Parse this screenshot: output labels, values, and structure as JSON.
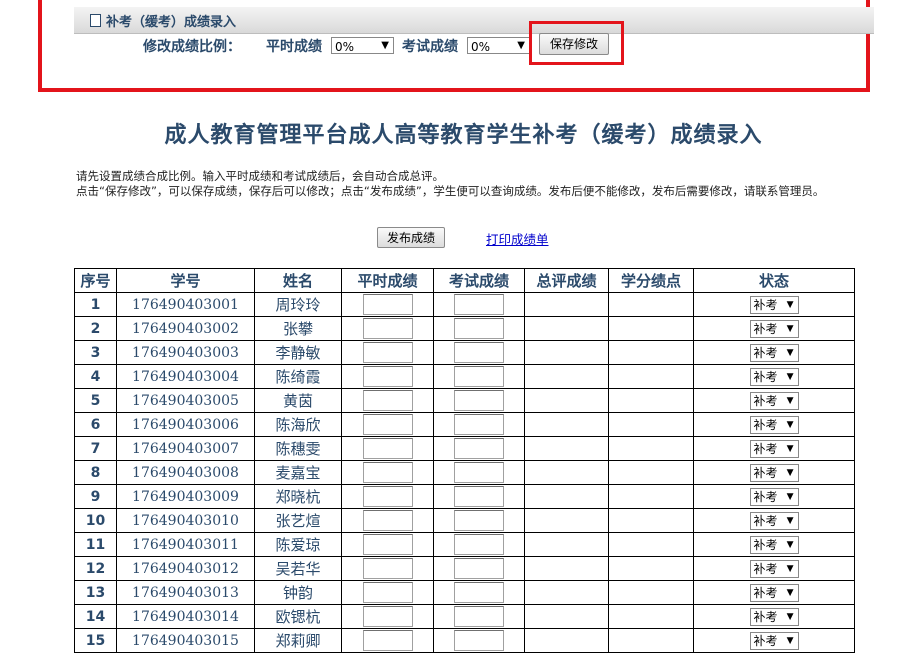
{
  "panel": {
    "title": "补考（缓考）成绩录入"
  },
  "ratio": {
    "label": "修改成绩比例：",
    "regular_label": "平时成绩",
    "regular_value": "0%",
    "exam_label": "考试成绩",
    "exam_value": "0%",
    "save_label": "保存修改"
  },
  "page_title": "成人教育管理平台成人高等教育学生补考（缓考）成绩录入",
  "notes": {
    "line1": "请先设置成绩合成比例。输入平时成绩和考试成绩后，会自动合成总评。",
    "line2": "点击“保存修改”，可以保存成绩，保存后可以修改；点击“发布成绩”，学生便可以查询成绩。发布后便不能修改，发布后需要修改，请联系管理员。"
  },
  "actions": {
    "publish_label": "发布成绩",
    "print_label": "打印成绩单"
  },
  "table": {
    "headers": [
      "序号",
      "学号",
      "姓名",
      "平时成绩",
      "考试成绩",
      "总评成绩",
      "学分绩点",
      "状态"
    ],
    "rows": [
      {
        "idx": "1",
        "sid": "176490403001",
        "name": "周玲玲",
        "status": "补考"
      },
      {
        "idx": "2",
        "sid": "176490403002",
        "name": "张攀",
        "status": "补考"
      },
      {
        "idx": "3",
        "sid": "176490403003",
        "name": "李静敏",
        "status": "补考"
      },
      {
        "idx": "4",
        "sid": "176490403004",
        "name": "陈绮霞",
        "status": "补考"
      },
      {
        "idx": "5",
        "sid": "176490403005",
        "name": "黄茵",
        "status": "补考"
      },
      {
        "idx": "6",
        "sid": "176490403006",
        "name": "陈海欣",
        "status": "补考"
      },
      {
        "idx": "7",
        "sid": "176490403007",
        "name": "陈穗雯",
        "status": "补考"
      },
      {
        "idx": "8",
        "sid": "176490403008",
        "name": "麦嘉宝",
        "status": "补考"
      },
      {
        "idx": "9",
        "sid": "176490403009",
        "name": "郑晓杭",
        "status": "补考"
      },
      {
        "idx": "10",
        "sid": "176490403010",
        "name": "张艺煊",
        "status": "补考"
      },
      {
        "idx": "11",
        "sid": "176490403011",
        "name": "陈爱琼",
        "status": "补考"
      },
      {
        "idx": "12",
        "sid": "176490403012",
        "name": "吴若华",
        "status": "补考"
      },
      {
        "idx": "13",
        "sid": "176490403013",
        "name": "钟韵",
        "status": "补考"
      },
      {
        "idx": "14",
        "sid": "176490403014",
        "name": "欧锶杭",
        "status": "补考"
      },
      {
        "idx": "15",
        "sid": "176490403015",
        "name": "郑莉卿",
        "status": "补考"
      }
    ]
  },
  "colors": {
    "accent": "#2b4a6b",
    "highlight": "#e3141b",
    "link": "#0000cc"
  }
}
